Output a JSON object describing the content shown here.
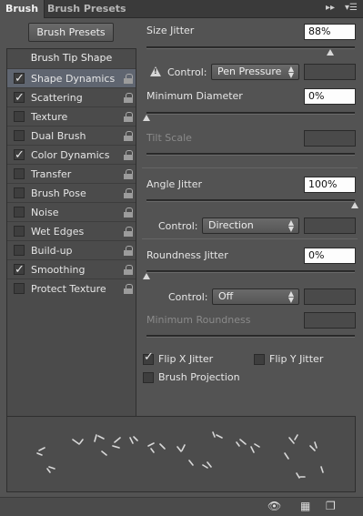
{
  "tabs": [
    {
      "label": "Brush",
      "active": true
    },
    {
      "label": "Brush Presets",
      "active": false
    }
  ],
  "panel_menu": {
    "collapse_icon": "double-chevron-right-icon",
    "menu_icon": "panel-menu-icon"
  },
  "left": {
    "brush_presets_button": "Brush Presets",
    "tip_shape_label": "Brush Tip Shape",
    "items": [
      {
        "label": "Shape Dynamics",
        "checked": true,
        "selected": true
      },
      {
        "label": "Scattering",
        "checked": true,
        "selected": false
      },
      {
        "label": "Texture",
        "checked": false,
        "selected": false
      },
      {
        "label": "Dual Brush",
        "checked": false,
        "selected": false
      },
      {
        "label": "Color Dynamics",
        "checked": true,
        "selected": false
      },
      {
        "label": "Transfer",
        "checked": false,
        "selected": false
      },
      {
        "label": "Brush Pose",
        "checked": false,
        "selected": false
      },
      {
        "label": "Noise",
        "checked": false,
        "selected": false
      },
      {
        "label": "Wet Edges",
        "checked": false,
        "selected": false
      },
      {
        "label": "Build-up",
        "checked": false,
        "selected": false
      },
      {
        "label": "Smoothing",
        "checked": true,
        "selected": false
      },
      {
        "label": "Protect Texture",
        "checked": false,
        "selected": false
      }
    ]
  },
  "right": {
    "size_jitter": {
      "label": "Size Jitter",
      "value": "88%",
      "level": 0.88
    },
    "size_control": {
      "label": "Control:",
      "value": "Pen Pressure"
    },
    "min_diameter": {
      "label": "Minimum Diameter",
      "value": "0%",
      "level": 0.0
    },
    "tilt_scale": {
      "label": "Tilt Scale"
    },
    "angle_jitter": {
      "label": "Angle Jitter",
      "value": "100%",
      "level": 1.0
    },
    "angle_control": {
      "label": "Control:",
      "value": "Direction"
    },
    "roundness_jitter": {
      "label": "Roundness Jitter",
      "value": "0%",
      "level": 0.0
    },
    "roundness_control": {
      "label": "Control:",
      "value": "Off"
    },
    "min_roundness": {
      "label": "Minimum Roundness"
    },
    "flip_x": {
      "label": "Flip X Jitter",
      "checked": true
    },
    "flip_y": {
      "label": "Flip Y Jitter",
      "checked": false
    },
    "brush_projection": {
      "label": "Brush Projection",
      "checked": false
    }
  },
  "bottom_icons": [
    "visibility-eye-icon",
    "grid-icon",
    "new-preset-icon"
  ]
}
